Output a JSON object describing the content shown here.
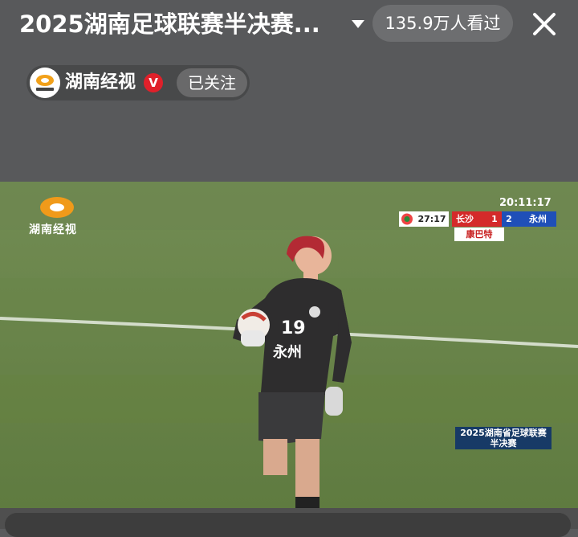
{
  "header": {
    "title": "2025湖南足球联赛半决赛...",
    "views": "135.9万人看过"
  },
  "channel": {
    "name": "湖南经视",
    "verified_badge": "V",
    "follow_label": "已关注"
  },
  "video": {
    "watermark_text": "湖南经视",
    "clock": "20:11:17",
    "match_time": "27:17",
    "home_team": "长沙",
    "home_score": "1",
    "away_score": "2",
    "away_team": "永州",
    "sponsor": "康巴特",
    "event_line1": "2025湖南省足球联赛",
    "event_line2": "半决赛",
    "player_number": "19",
    "jersey_text": "永州"
  },
  "colors": {
    "topbar_bg": "#58595b",
    "pitch_green": "#6e8a4e",
    "home_red": "#d42a2a",
    "away_blue": "#1f4fb8"
  },
  "icons": [
    "chevron-down-icon",
    "close-icon",
    "verified-icon"
  ]
}
